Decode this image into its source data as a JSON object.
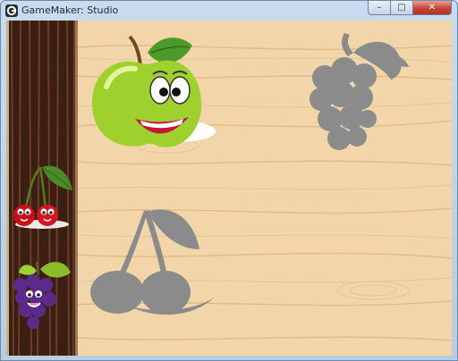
{
  "window": {
    "title": "GameMaker: Studio",
    "buttons": {
      "minimize": "–",
      "maximize": "□",
      "close": "✕"
    }
  },
  "game": {
    "sidebar_items": [
      "cherries",
      "grapes"
    ],
    "board_items": [
      "apple",
      "grapes-silhouette",
      "cherries-silhouette"
    ]
  },
  "colors": {
    "wood_light": "#f2d6aa",
    "wood_grain": "#e3b981",
    "bark_dark": "#3a1f12",
    "silhouette": "#8b8b8b"
  }
}
